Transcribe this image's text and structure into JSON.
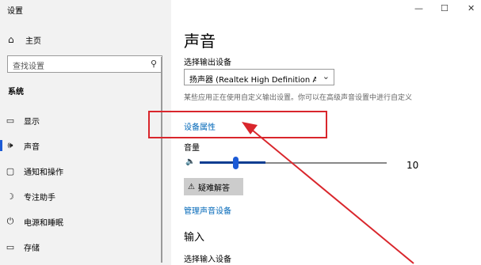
{
  "window": {
    "title": "设置",
    "controls": [
      "—",
      "☐",
      "✕"
    ]
  },
  "sidebar": {
    "home": {
      "icon": "home-icon",
      "label": "主页"
    },
    "search": {
      "placeholder": "查找设置",
      "icon": "search-icon"
    },
    "section": "系统",
    "items": [
      {
        "icon": "display-icon",
        "label": "显示"
      },
      {
        "icon": "speaker-icon",
        "label": "声音"
      },
      {
        "icon": "notification-icon",
        "label": "通知和操作"
      },
      {
        "icon": "focus-assist-icon",
        "label": "专注助手"
      },
      {
        "icon": "power-icon",
        "label": "电源和睡眠"
      },
      {
        "icon": "storage-icon",
        "label": "存储"
      }
    ],
    "selected_index": 1
  },
  "main": {
    "title": "声音",
    "output_label": "选择输出设备",
    "output_device": "扬声器 (Realtek High Definition Audi...",
    "description": "某些应用正在使用自定义输出设置。你可以在高级声音设置中进行自定义",
    "device_properties": "设备属性",
    "volume_label": "音量",
    "volume_value": "10",
    "volume_fraction": 0.1,
    "troubleshoot": "疑难解答",
    "manage_devices": "管理声音设备",
    "input_title": "输入",
    "input_label": "选择输入设备"
  },
  "colors": {
    "accent": "#0067b8",
    "annotation": "#d9262c",
    "slider": "#1c5bd6"
  }
}
